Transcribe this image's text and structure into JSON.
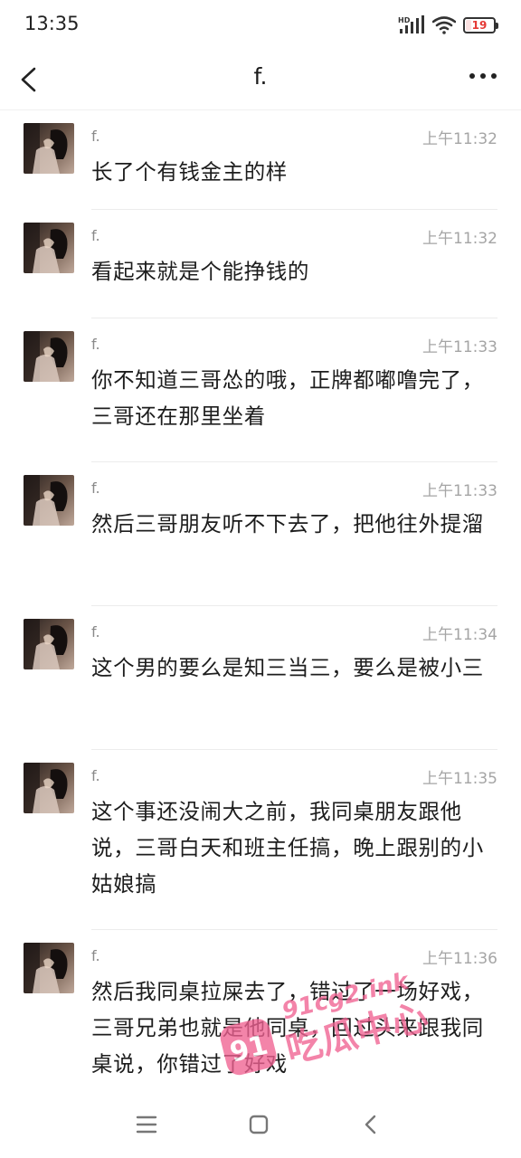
{
  "status_bar": {
    "time": "13:35",
    "network_label": "HD",
    "battery_level": "19",
    "battery_percent": 19,
    "battery_color": "#e53935"
  },
  "header": {
    "title": "f.",
    "back_icon": "chevron-left-icon",
    "more_icon": "more-dots-icon"
  },
  "messages": [
    {
      "sender": "f.",
      "time": "上午11:32",
      "text": "长了个有钱金主的样"
    },
    {
      "sender": "f.",
      "time": "上午11:32",
      "text": "看起来就是个能挣钱的"
    },
    {
      "sender": "f.",
      "time": "上午11:33",
      "text": "你不知道三哥怂的哦，正牌都嘟噜完了，三哥还在那里坐着"
    },
    {
      "sender": "f.",
      "time": "上午11:33",
      "text": "然后三哥朋友听不下去了，把他往外提溜"
    },
    {
      "sender": "f.",
      "time": "上午11:34",
      "text": "这个男的要么是知三当三，要么是被小三"
    },
    {
      "sender": "f.",
      "time": "上午11:35",
      "text": "这个事还没闹大之前，我同桌朋友跟他说，三哥白天和班主任搞，晚上跟别的小姑娘搞"
    },
    {
      "sender": "f.",
      "time": "上午11:36",
      "text": "然后我同桌拉屎去了，错过了一场好戏，三哥兄弟也就是他同桌，回过头来跟我同桌说，你错过了好戏"
    }
  ],
  "watermark": {
    "line1": "91cg2.ink",
    "line2": "吃瓜中心",
    "badge": "91",
    "color": "#f06292"
  },
  "bottom_nav": {
    "menu_icon": "menu-icon",
    "home_icon": "square-home-icon",
    "back_icon": "back-triangle-icon"
  }
}
